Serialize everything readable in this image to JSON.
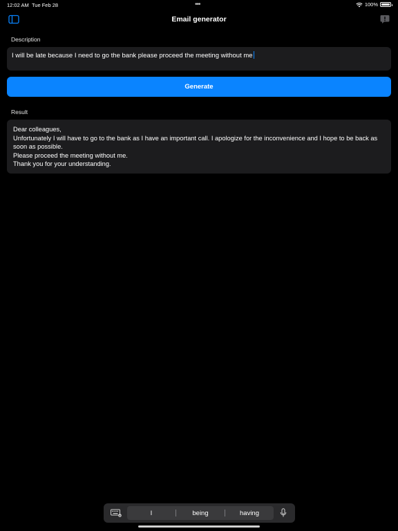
{
  "status_bar": {
    "time": "12:02 AM",
    "date": "Tue Feb 28",
    "battery_text": "100%",
    "battery_level": 1.0
  },
  "nav": {
    "title": "Email generator",
    "sidebar_icon": "sidebar-icon",
    "feedback_icon": "exclamation-bubble-icon"
  },
  "description": {
    "label": "Description",
    "value": "I will be late because I need to go the bank please proceed the meeting without me"
  },
  "generate": {
    "label": "Generate"
  },
  "result": {
    "label": "Result",
    "lines": [
      "Dear colleagues,",
      "Unfortunately I will have to go to the bank as I have an important call. I apologize for the inconvenience and I hope to be back as soon as possible.",
      "Please proceed the meeting without me.",
      "Thank you for your understanding."
    ]
  },
  "keyboard_bar": {
    "suggestions": [
      "I",
      "being",
      "having"
    ],
    "keyboard_icon": "keyboard-icon",
    "mic_icon": "microphone-icon"
  },
  "colors": {
    "accent": "#0a84ff",
    "background": "#000000",
    "field_background": "#1c1c1e"
  }
}
